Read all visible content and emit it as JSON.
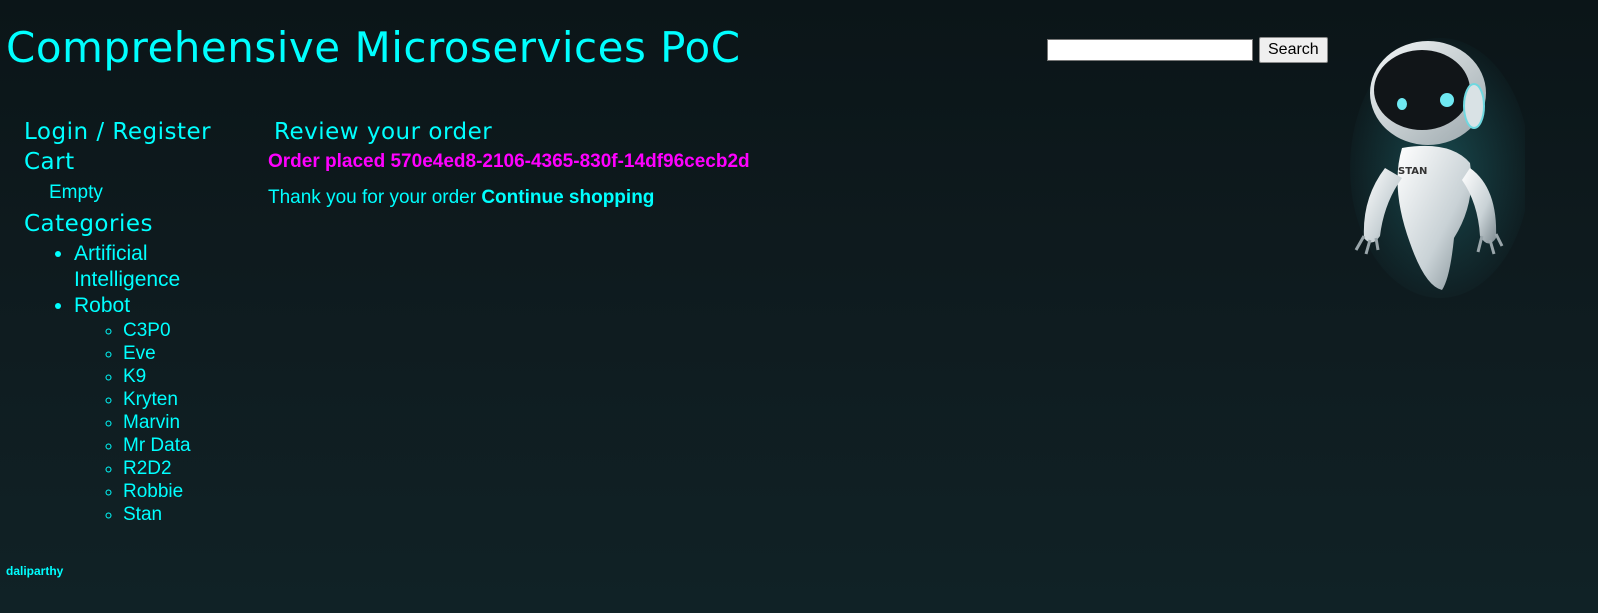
{
  "header": {
    "title": "Comprehensive Microservices PoC",
    "search": {
      "value": "",
      "placeholder": "",
      "button_label": "Search"
    }
  },
  "mascot": {
    "label": "STAN"
  },
  "sidebar": {
    "login_label": "Login / Register",
    "cart": {
      "heading": "Cart",
      "status": "Empty"
    },
    "categories": {
      "heading": "Categories",
      "items": [
        {
          "label": "Artificial Intelligence"
        },
        {
          "label": "Robot"
        }
      ],
      "robot_items": [
        {
          "label": "C3P0"
        },
        {
          "label": "Eve"
        },
        {
          "label": "K9"
        },
        {
          "label": "Kryten"
        },
        {
          "label": "Marvin"
        },
        {
          "label": "Mr Data"
        },
        {
          "label": "R2D2"
        },
        {
          "label": "Robbie"
        },
        {
          "label": "Stan"
        }
      ]
    }
  },
  "main": {
    "heading": "Review your order",
    "order_placed": "Order placed 570e4ed8-2106-4365-830f-14df96cecb2d",
    "thank_you": "Thank you for your order",
    "continue_label": "Continue shopping"
  },
  "footer": {
    "text": "daliparthy"
  },
  "colors": {
    "accent": "#00ffff",
    "highlight": "#ff00ff",
    "background": "#0d191c"
  }
}
